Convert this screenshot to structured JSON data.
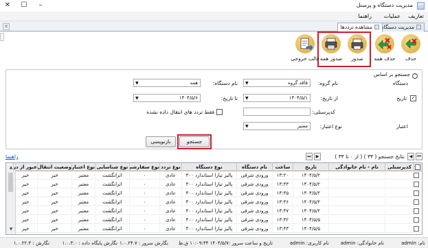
{
  "window": {
    "title": "مدیریت دستگاه و پرسنل"
  },
  "menu": {
    "items": [
      "تعاریف",
      "عملیات",
      "راهنما"
    ]
  },
  "tabs": [
    {
      "label": "مدیریت دستگاه"
    },
    {
      "label": "مشاهده ترددها"
    }
  ],
  "toolbar": {
    "delete_label": "حذف",
    "delete_all_label": "حذف همه",
    "export_label": "صدور",
    "export_all_label": "صدور همه",
    "output_template_label": "قالب خروجی"
  },
  "search": {
    "header": "جستجو بر اساس",
    "device_label": "دستگاه",
    "group_label": "نام گروه:",
    "group_value": "فاقد گروه",
    "device_name_label": "نام دستگاه:",
    "device_name_value": "همه",
    "date_label": "تاریخ",
    "date_checked": true,
    "from_date_label": "از تاریخ:",
    "from_date_value": "۱۴۰۴/۵/۱",
    "to_date_label": "تا تاریخ:",
    "to_date_value": "۱۴۰۴/۵/۶",
    "only_unsynced_label": "فقط تردد های انتقال داده نشده",
    "only_unsynced_checked": false,
    "personnel_code_label": "کدپرسنلی:",
    "personnel_code_value": "",
    "validity_label": "اعتبار",
    "validity_type_label": "نوع اعتبار:",
    "validity_type_value": "معتبر",
    "search_button": "جستجو",
    "reset_button": "بازنویسی"
  },
  "results": {
    "summary": "نتایج جستجو ( ۳۳ ) ( از ۰ تا ۳۳ )",
    "guide_link": "راهنما"
  },
  "grid": {
    "columns": [
      "کدپرسنلی",
      "نام - نام خانوادگی",
      "تاریخ",
      "ساعت",
      "نام دستگاه",
      "نوع دستگاه",
      "نوع تردد",
      "نوع سفارشی",
      "نوع شناسایی",
      "نوع اعتبار",
      "وضعیت انتقال داده",
      "عبور از در"
    ],
    "rows": [
      [
        "",
        "",
        "۱۴۰۴/۵/۲",
        "۱۳:۲۰",
        "ورودی شرقی",
        "پالیز تیارا استاندارد ۴۰۰",
        "عادی",
        "۰",
        "اثرانگشت",
        "معتبر",
        "خیر",
        "خیر"
      ],
      [
        "",
        "",
        "۱۴۰۴/۵/۲",
        "۱۳:۴۳",
        "ورودی شرقی",
        "پالیز تیارا استاندارد ۴۰۰",
        "عادی",
        "۰",
        "اثرانگشت",
        "معتبر",
        "خیر",
        "خیر"
      ],
      [
        "",
        "",
        "۱۴۰۴/۵/۲",
        "۱۳:۴۵",
        "ورودی شرقی",
        "پالیز تیارا استاندارد ۴۰۰",
        "عادی",
        "۰",
        "اثرانگشت",
        "معتبر",
        "خیر",
        "خیر"
      ],
      [
        "",
        "",
        "۱۴۰۴/۵/۲",
        "۱۳:۴۶",
        "ورودی شرقی",
        "پالیز تیارا استاندارد ۴۰۰",
        "عادی",
        "۰",
        "اثرانگشت",
        "معتبر",
        "خیر",
        "خیر"
      ],
      [
        "",
        "",
        "۱۴۰۴/۵/۲",
        "۱۳:۴۷",
        "ورودی شرقی",
        "پالیز تیارا استاندارد ۴۰۰",
        "عادی",
        "۰",
        "اثرانگشت",
        "معتبر",
        "خیر",
        "خیر"
      ],
      [
        "",
        "",
        "۱۴۰۴/۵/۵",
        "۱۳:۴۲",
        "ورودی شرقی",
        "پالیز تیارا استاندارد ۴۰۰",
        "عادی",
        "۰",
        "اثرانگشت",
        "معتبر",
        "خیر",
        "خیر"
      ],
      [
        "",
        "",
        "۱۴۰۴/۵/۵",
        "۱۳:۴۳",
        "ورودی شرقی",
        "پالیز تیارا استاندارد ۴۰۰",
        "عادی",
        "۰",
        "اثرانگشت",
        "معتبر",
        "خیر",
        "خیر"
      ]
    ]
  },
  "statusbar": {
    "name": "نام: admin",
    "family": "نام خانوادگی: admin",
    "username": "نام کاربری: admin",
    "server_datetime": "تاریخ و ساعت سرور :۱۴۰۴/۵/۷ ۱۰:۰۹:۳۴ ق.ظ",
    "server_version": "نگارش سرور : ۱.۰.۲۴.۷",
    "db_version": "نگارش پایگاه داده : ۱.۰.۳.۰",
    "version": "نگارش : ۱.۰.۲۲.۴"
  },
  "colors": {
    "highlight": "#d11a2a",
    "header_bg": "#e9e9e9",
    "tab_border": "#9aa8bd"
  },
  "icons": [
    "delete-icon",
    "delete-all-icon",
    "export-printer-icon",
    "export-all-printer-icon",
    "output-template-icon"
  ]
}
